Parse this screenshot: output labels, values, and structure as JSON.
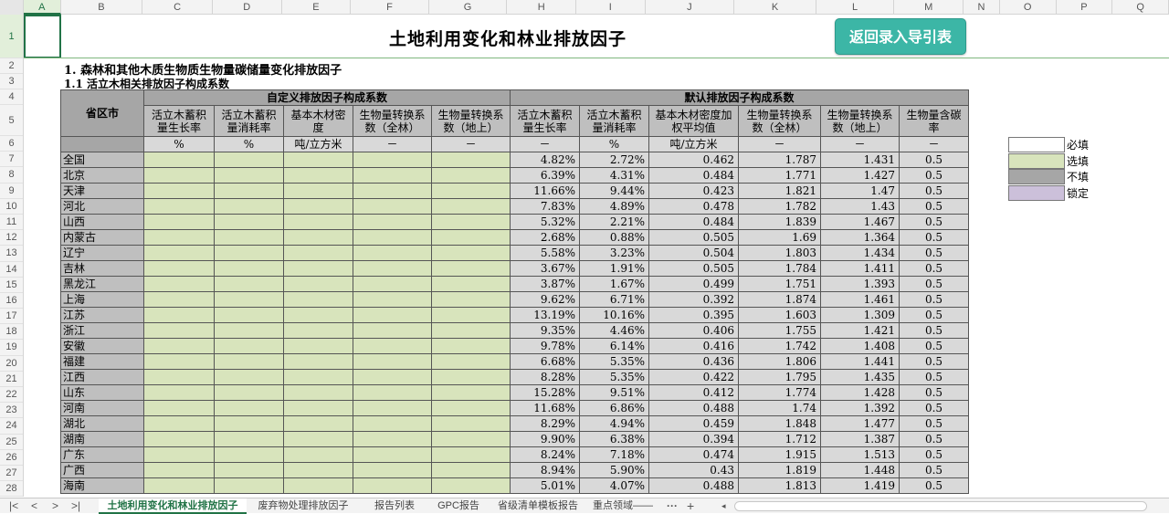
{
  "column_headers": [
    "A",
    "B",
    "C",
    "D",
    "E",
    "F",
    "G",
    "H",
    "I",
    "J",
    "K",
    "L",
    "M",
    "N",
    "O",
    "P",
    "Q"
  ],
  "row_headers": [
    "1",
    "2",
    "3",
    "4",
    "5",
    "6",
    "7",
    "8",
    "9",
    "10",
    "11",
    "12",
    "13",
    "14",
    "15",
    "16",
    "17",
    "18",
    "19",
    "20",
    "21",
    "22",
    "23",
    "24",
    "25",
    "26",
    "27",
    "28"
  ],
  "title": "土地利用变化和林业排放因子",
  "nav_button": "返回录入导引表",
  "section1": "1.  森林和其他木质生物质生物量碳储量变化排放因子",
  "section2": "1.1 活立木相关排放因子构成系数",
  "table": {
    "province_header": "省区市",
    "group_custom": "自定义排放因子构成系数",
    "group_default": "默认排放因子构成系数",
    "custom_cols": [
      {
        "l1": "活立木蓄积",
        "l2": "量生长率",
        "unit": "%"
      },
      {
        "l1": "活立木蓄积",
        "l2": "量消耗率",
        "unit": "%"
      },
      {
        "l1": "基本木材密",
        "l2": "度",
        "unit": "吨/立方米"
      },
      {
        "l1": "生物量转换系",
        "l2": "数（全林）",
        "unit": "－"
      },
      {
        "l1": "生物量转换系",
        "l2": "数（地上）",
        "unit": "－"
      }
    ],
    "default_cols": [
      {
        "l1": "活立木蓄积",
        "l2": "量生长率",
        "unit": "－"
      },
      {
        "l1": "活立木蓄积",
        "l2": "量消耗率",
        "unit": "%"
      },
      {
        "l1": "基本木材密度加",
        "l2": "权平均值",
        "unit": "吨/立方米"
      },
      {
        "l1": "生物量转换系",
        "l2": "数（全林）",
        "unit": "－"
      },
      {
        "l1": "生物量转换系",
        "l2": "数（地上）",
        "unit": "－"
      },
      {
        "l1": "生物量含碳",
        "l2": "率",
        "unit": "－"
      }
    ],
    "rows": [
      {
        "name": "全国",
        "v": [
          "4.82%",
          "2.72%",
          "0.462",
          "1.787",
          "1.431",
          "0.5"
        ]
      },
      {
        "name": "北京",
        "v": [
          "6.39%",
          "4.31%",
          "0.484",
          "1.771",
          "1.427",
          "0.5"
        ]
      },
      {
        "name": "天津",
        "v": [
          "11.66%",
          "9.44%",
          "0.423",
          "1.821",
          "1.47",
          "0.5"
        ]
      },
      {
        "name": "河北",
        "v": [
          "7.83%",
          "4.89%",
          "0.478",
          "1.782",
          "1.43",
          "0.5"
        ]
      },
      {
        "name": "山西",
        "v": [
          "5.32%",
          "2.21%",
          "0.484",
          "1.839",
          "1.467",
          "0.5"
        ]
      },
      {
        "name": "内蒙古",
        "v": [
          "2.68%",
          "0.88%",
          "0.505",
          "1.69",
          "1.364",
          "0.5"
        ]
      },
      {
        "name": "辽宁",
        "v": [
          "5.58%",
          "3.23%",
          "0.504",
          "1.803",
          "1.434",
          "0.5"
        ]
      },
      {
        "name": "吉林",
        "v": [
          "3.67%",
          "1.91%",
          "0.505",
          "1.784",
          "1.411",
          "0.5"
        ]
      },
      {
        "name": "黑龙江",
        "v": [
          "3.87%",
          "1.67%",
          "0.499",
          "1.751",
          "1.393",
          "0.5"
        ]
      },
      {
        "name": "上海",
        "v": [
          "9.62%",
          "6.71%",
          "0.392",
          "1.874",
          "1.461",
          "0.5"
        ]
      },
      {
        "name": "江苏",
        "v": [
          "13.19%",
          "10.16%",
          "0.395",
          "1.603",
          "1.309",
          "0.5"
        ]
      },
      {
        "name": "浙江",
        "v": [
          "9.35%",
          "4.46%",
          "0.406",
          "1.755",
          "1.421",
          "0.5"
        ]
      },
      {
        "name": "安徽",
        "v": [
          "9.78%",
          "6.14%",
          "0.416",
          "1.742",
          "1.408",
          "0.5"
        ]
      },
      {
        "name": "福建",
        "v": [
          "6.68%",
          "5.35%",
          "0.436",
          "1.806",
          "1.441",
          "0.5"
        ]
      },
      {
        "name": "江西",
        "v": [
          "8.28%",
          "5.35%",
          "0.422",
          "1.795",
          "1.435",
          "0.5"
        ]
      },
      {
        "name": "山东",
        "v": [
          "15.28%",
          "9.51%",
          "0.412",
          "1.774",
          "1.428",
          "0.5"
        ]
      },
      {
        "name": "河南",
        "v": [
          "11.68%",
          "6.86%",
          "0.488",
          "1.74",
          "1.392",
          "0.5"
        ]
      },
      {
        "name": "湖北",
        "v": [
          "8.29%",
          "4.94%",
          "0.459",
          "1.848",
          "1.477",
          "0.5"
        ]
      },
      {
        "name": "湖南",
        "v": [
          "9.90%",
          "6.38%",
          "0.394",
          "1.712",
          "1.387",
          "0.5"
        ]
      },
      {
        "name": "广东",
        "v": [
          "8.24%",
          "7.18%",
          "0.474",
          "1.915",
          "1.513",
          "0.5"
        ]
      },
      {
        "name": "广西",
        "v": [
          "8.94%",
          "5.90%",
          "0.43",
          "1.819",
          "1.448",
          "0.5"
        ]
      },
      {
        "name": "海南",
        "v": [
          "5.01%",
          "4.07%",
          "0.488",
          "1.813",
          "1.419",
          "0.5"
        ]
      }
    ]
  },
  "legend": [
    {
      "label": "必填",
      "color": "#ffffff"
    },
    {
      "label": "选填",
      "color": "#d8e4bc"
    },
    {
      "label": "不填",
      "color": "#a6a6a6"
    },
    {
      "label": "锁定",
      "color": "#ccc0da"
    }
  ],
  "sheet_tabs": [
    "土地利用变化和林业排放因子",
    "废弃物处理排放因子",
    "报告列表",
    "GPC报告",
    "省级清单模板报告",
    "重点领域——"
  ],
  "tab_nav": {
    "first": "|<",
    "prev": "<",
    "next": ">",
    "last": ">|",
    "more": "···",
    "add": "+",
    "scroll_left": "◂"
  }
}
